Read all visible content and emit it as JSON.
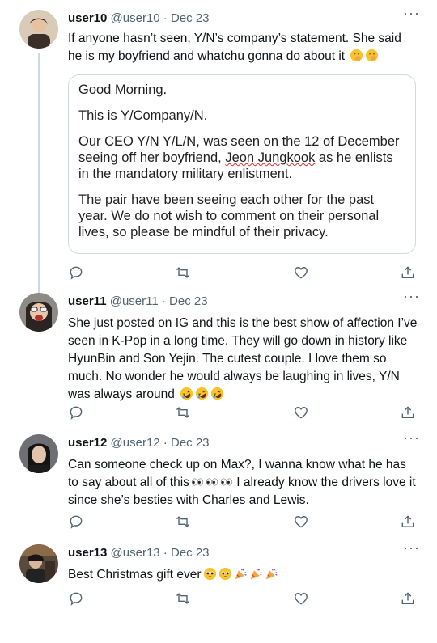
{
  "tweets": [
    {
      "user": "user10",
      "handle": "@user10",
      "date": "Dec 23",
      "text": "If anyone hasn’t seen, Y/N’s company’s statement. She said he is my boyfriend and whatchu gonna do about it",
      "emojis": [
        "hand-over-mouth-emoji",
        "hand-over-mouth-emoji"
      ],
      "statement": {
        "greeting": "Good Morning.",
        "intro": "This is Y/Company/N.",
        "p1_before": "Our CEO Y/N Y/L/N, was seen on the 12 of December seeing off her boyfriend, ",
        "p1_name": "Jeon Jungkook",
        "p1_after": " as he enlists in the mandatory military enlistment.",
        "p2": "The pair have been seeing each other for the past year. We do not wish to comment on their personal lives, so please be mindful of their privacy."
      }
    },
    {
      "user": "user11",
      "handle": "@user11",
      "date": "Dec 23",
      "text": "She just posted on IG and this is the best show of affection I’ve seen in K-Pop in a long time. They will go down in history like HyunBin and Son Yejin. The cutest couple. I love them so much. No wonder he would always be laughing in lives, Y/N was always around",
      "emojis": [
        "rofl-emoji",
        "rofl-emoji",
        "rofl-emoji"
      ]
    },
    {
      "user": "user12",
      "handle": "@user12",
      "date": "Dec 23",
      "text_a": "Can someone check up on Max?, I wanna know what he has to say about all of this",
      "text_b": " I already know the drivers love it since she’s besties with Charles and Lewis.",
      "emojis": [
        "eyes-emoji",
        "eyes-emoji",
        "eyes-emoji"
      ]
    },
    {
      "user": "user13",
      "handle": "@user13",
      "date": "Dec 23",
      "text": "Best Christmas gift ever",
      "emojis": [
        "pleading-face-emoji",
        "pleading-face-emoji",
        "party-popper-emoji",
        "party-popper-emoji",
        "party-popper-emoji"
      ]
    }
  ],
  "separator": " · ",
  "more_label": "···",
  "colors": {
    "text": "#0f1419",
    "muted": "#536471",
    "border": "#cfd9de"
  }
}
